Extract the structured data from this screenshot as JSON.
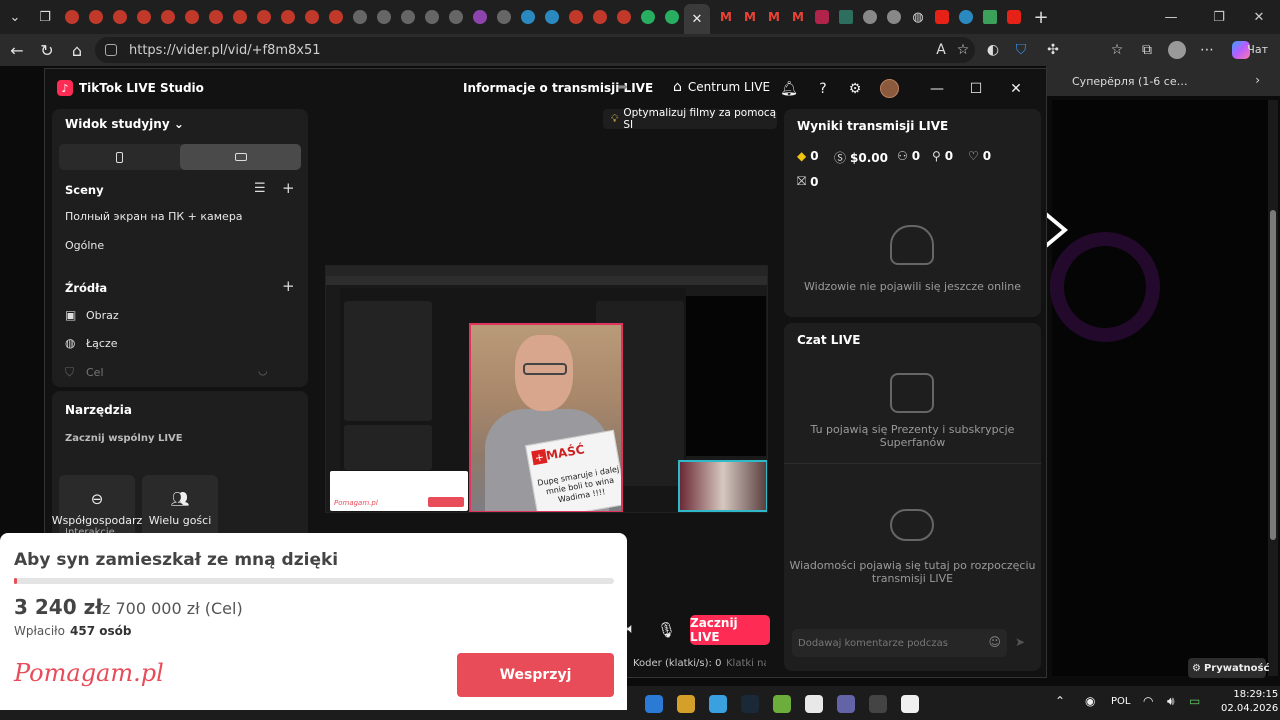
{
  "browser": {
    "url": "https://vider.pl/vid/+f8m8x51",
    "chat_label": "Чат",
    "bookmark_label": "Суперёрля (1-6 се…",
    "privacy_label": "Prywatność",
    "tab_favicon_colors": [
      "#c0392b",
      "#c0392b",
      "#c0392b",
      "#c0392b",
      "#c0392b",
      "#c0392b",
      "#c0392b",
      "#c0392b",
      "#c0392b",
      "#c0392b",
      "#c0392b",
      "#c0392b",
      "#666666",
      "#666666",
      "#666666",
      "#666666",
      "#666666",
      "#8e44ad",
      "#666666",
      "#2a8ac0",
      "#2a8ac0",
      "#c0392b",
      "#c0392b",
      "#c0392b",
      "#27ae60",
      "#27ae60"
    ]
  },
  "studio": {
    "app_name": "TikTok LIVE Studio",
    "header_title": "Informacje o transmisji LIVE",
    "centrum_label": "Centrum LIVE",
    "view_label": "Widok studyjny",
    "scenes_header": "Sceny",
    "scenes": [
      "Полный экран на ПК + камера",
      "Ogólne"
    ],
    "sources_header": "Źródła",
    "sources": [
      "Obraz",
      "Łącze",
      "Cel"
    ],
    "tools_header": "Narzędzia",
    "tools_sub": "Zacznij wspólny LIVE",
    "tool_cohost": "Współgospodarz",
    "tool_multi": "Wielu gości",
    "interactions_label": "Interakcje",
    "tip": "Optymalizuj filmy za pomocą SI",
    "start_btn": "Zacznij LIVE",
    "encoder": "Koder (klatki/s):  0",
    "frames": "Klatki na",
    "results_header": "Wyniki transmisji LIVE",
    "stats": {
      "diamonds": "0",
      "money": "$0.00",
      "viewers": "0",
      "new_followers": "0",
      "likes": "0",
      "gifts": "0"
    },
    "viewers_empty": "Widzowie nie pojawili się jeszcze online",
    "chat_header": "Czat LIVE",
    "gifts_empty": "Tu pojawią się Prezenty i subskrypcje Superfanów",
    "messages_empty": "Wiadomości pojawią się tutaj po rozpoczęciu transmisji LIVE",
    "comment_placeholder": "Dodawaj komentarze podczas"
  },
  "preview": {
    "sign_head": "MAŚĆ",
    "sign_text": "Dupę smaruje i dalej mnie boli to wina Wadima !!!!"
  },
  "pomagam": {
    "title": "Aby syn zamieszkał ze mną dzięki",
    "raised": "3 240 zł",
    "goal": "z 700 000 zł (Cel)",
    "progress_fraction": 0.0046,
    "donors_label": "Wpłaciło",
    "donors_count": "457 osób",
    "logo": "Pomagam.pl",
    "button": "Wesprzyj"
  },
  "taskbar": {
    "lang": "POL",
    "time": "18:29:15",
    "date": "02.04.2026",
    "icon_colors": [
      "#2a7ad6",
      "#d4a02a",
      "#3aa0e0",
      "#1b2838",
      "#6cae3c",
      "#e8e8e8",
      "#6264a7",
      "#444444",
      "#f0f0f0"
    ]
  }
}
